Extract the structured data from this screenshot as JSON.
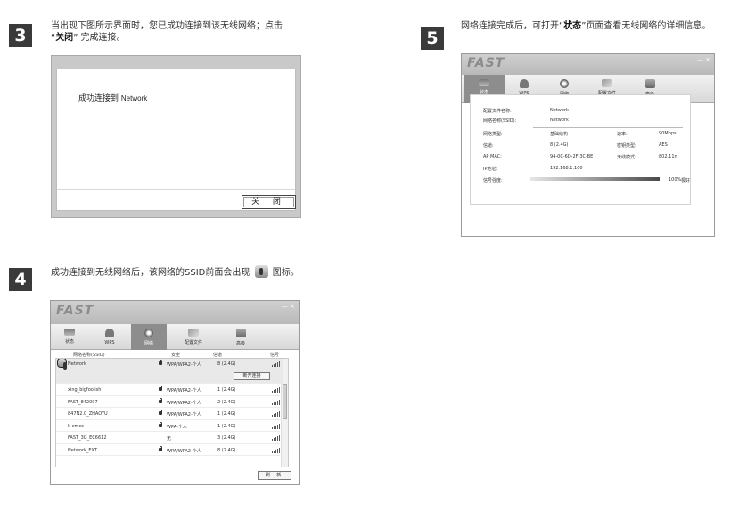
{
  "step3": {
    "number": "3",
    "text_before": "当出现下图所示界面时，您已成功连接到该无线网络；点击",
    "text_bold": "关闭",
    "text_after": "完成连接。",
    "dialog": {
      "message_prefix": "成功连接到",
      "network": "Network",
      "close_label": "关 闭"
    }
  },
  "step4": {
    "number": "4",
    "text_before": "成功连接到无线网络后，该网络的SSID前面会出现",
    "text_after": "图标。",
    "app": {
      "logo": "FAST",
      "window_controls": "— ×",
      "tabs": [
        "状态",
        "WPS",
        "网络",
        "配置文件",
        "高级"
      ],
      "active_tab": 2,
      "columns": {
        "ssid": "网络名称(SSID)",
        "security": "安全",
        "channel": "信道",
        "signal": "信号"
      },
      "disconnect_label": "断开连接",
      "refresh_label": "刷 新",
      "networks": [
        {
          "ssid": "Network",
          "security": "WPA/WPA2-个人",
          "locked": true,
          "channel": "8 (2.4G)",
          "signal": 4
        },
        {
          "ssid": "xing_bigfoolish",
          "security": "WPA/WPA2-个人",
          "locked": true,
          "channel": "1 (2.4G)",
          "signal": 4
        },
        {
          "ssid": "FAST_842007",
          "security": "WPA/WPA2-个人",
          "locked": true,
          "channel": "2 (2.4G)",
          "signal": 4
        },
        {
          "ssid": "847N2.0_ZHAOYU",
          "security": "WPA/WPA2-个人",
          "locked": true,
          "channel": "1 (2.4G)",
          "signal": 4
        },
        {
          "ssid": "k-cmcc",
          "security": "WPA-个人",
          "locked": true,
          "channel": "1 (2.4G)",
          "signal": 4
        },
        {
          "ssid": "FAST_3G_EC6612",
          "security": "无",
          "locked": false,
          "channel": "3 (2.4G)",
          "signal": 4
        },
        {
          "ssid": "Network_EXT",
          "security": "WPA/WPA2-个人",
          "locked": true,
          "channel": "8 (2.4G)",
          "signal": 4
        }
      ]
    }
  },
  "step5": {
    "number": "5",
    "text_before": "网络连接完成后，可打开",
    "text_bold": "状态",
    "text_after": "页面查看无线网络的详细信息。",
    "app": {
      "logo": "FAST",
      "window_controls": "— ×",
      "tabs": [
        "状态",
        "WPS",
        "网络",
        "配置文件",
        "高级"
      ],
      "active_tab": 0,
      "profile_label": "配置文件名称:",
      "profile_value": "Network",
      "ssid_label": "网络名称(SSID):",
      "ssid_value": "Network",
      "net_type_label": "网络类型:",
      "net_type_value": "基础结构",
      "rate_label": "速率:",
      "rate_value": "90Mbps",
      "channel_label": "信道:",
      "channel_value": "8 (2.4G)",
      "cipher_label": "密钥类型:",
      "cipher_value": "AES",
      "mac_label": "AP MAC:",
      "mac_value": "94-0C-6D-2F-3C-BE",
      "mode_label": "无线模式:",
      "mode_value": "802.11n",
      "ip_label": "IP地址:",
      "ip_value": "192.168.1.100",
      "signal_label": "信号强度:",
      "signal_value": "100%",
      "signal_quality": "极好"
    }
  }
}
